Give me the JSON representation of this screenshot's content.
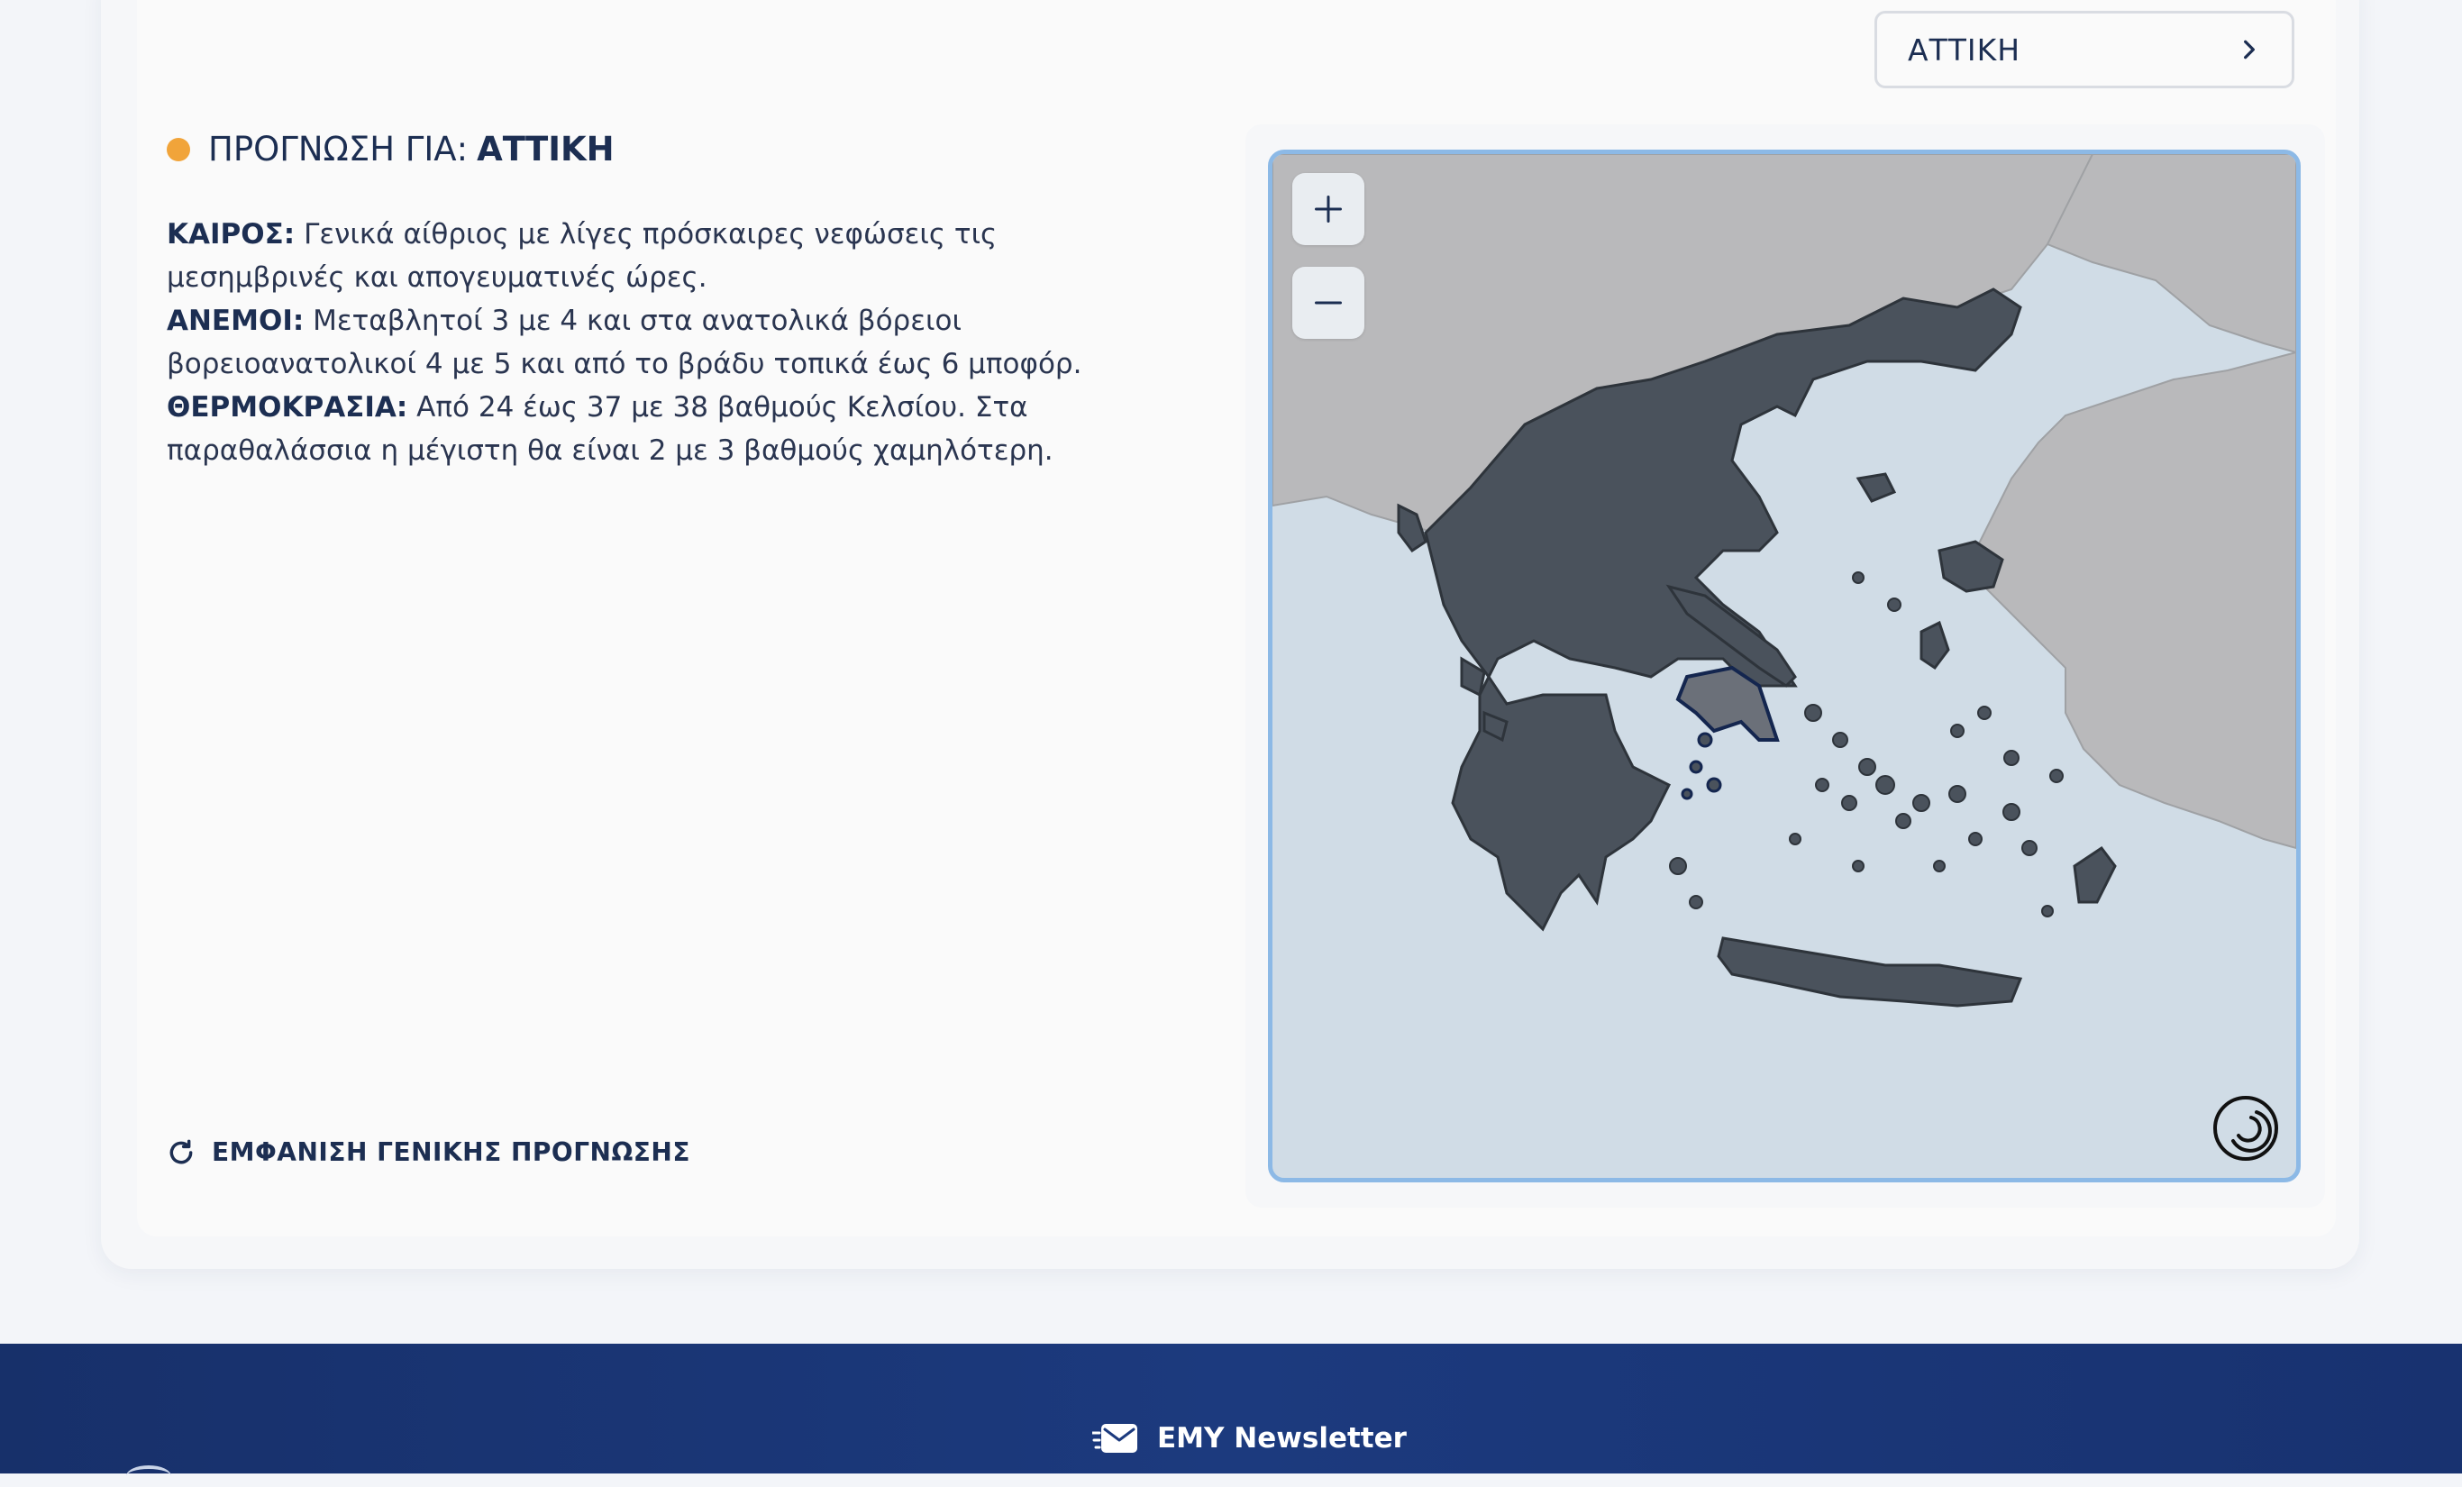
{
  "region_selector": {
    "value": "ΑΤΤΙΚΗ",
    "icon": "chevron-right-icon"
  },
  "forecast_header": {
    "prefix": "ΠΡΟΓΝΩΣΗ ΓΙΑ:",
    "region": "ΑΤΤΙΚΗ",
    "status_color": "#f1a43a"
  },
  "forecast": {
    "weather_label": "ΚΑΙΡΟΣ:",
    "weather_text": "Γενικά αίθριος με λίγες πρόσκαιρες νεφώσεις τις μεσημβρινές και απογευματινές ώρες.",
    "winds_label": "ΑΝΕΜΟΙ:",
    "winds_text": "Μεταβλητοί 3 με 4 και στα ανατολικά βόρειοι βορειοανατολικοί 4 με 5 και από το βράδυ τοπικά έως 6 μποφόρ.",
    "temperature_label": "ΘΕΡΜΟΚΡΑΣΙΑ:",
    "temperature_text": "Από 24 έως 37 με 38 βαθμούς Κελσίου. Στα παραθαλάσσια η μέγιστη θα είναι 2 με 3 βαθμούς χαμηλότερη."
  },
  "general_forecast_link": {
    "label": "ΕΜΦΑΝΙΣΗ ΓΕΝΙΚΗΣ ΠΡΟΓΝΩΣΗΣ",
    "icon": "refresh-icon"
  },
  "map": {
    "zoom_in_icon": "plus-icon",
    "zoom_out_icon": "minus-icon",
    "selected_region": "ΑΤΤΙΚΗ",
    "colors": {
      "sea": "#d0dce6",
      "land": "#b9b9bb",
      "greece": "#4a525c",
      "selected": "#6b7079",
      "frame": "#8cb9e6"
    }
  },
  "footer": {
    "newsletter_label": "EMY Newsletter",
    "newsletter_icon": "mail-icon",
    "background": "#1c3a7e"
  }
}
